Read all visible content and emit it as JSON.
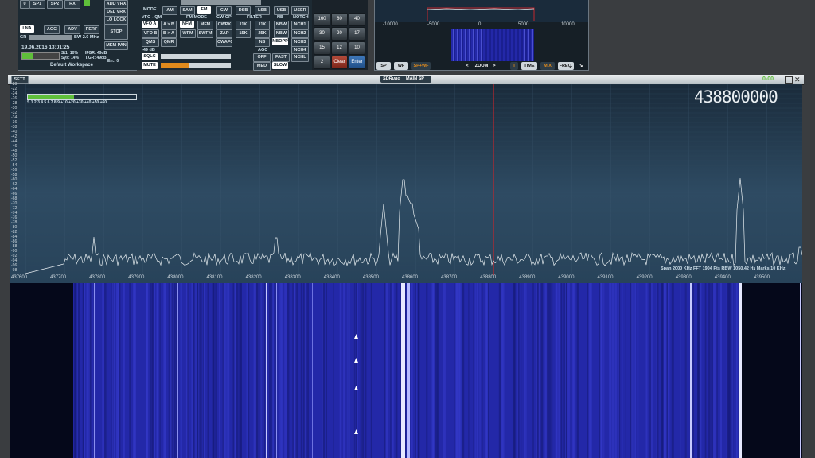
{
  "colors": {
    "accent": "#e08a1c",
    "panel": "#1d2a33",
    "spectrum_line": "#e6edf0",
    "waterfall": "#2328a8",
    "marker": "#c1272d",
    "smeter": "#5fbf3a"
  },
  "top_left": {
    "sp1": "SP1",
    "sp2": "SP2",
    "rx": "RX",
    "add_vrx": "ADD VRX",
    "del_vrx": "DEL VRX",
    "lo_lock": "LO LOCK",
    "lna": "LNA",
    "agc": "AGC",
    "adv": "ADV",
    "perf": "PERF",
    "gr": "GR",
    "bw": "BW 2.0 MHz",
    "stop": "STOP",
    "mem_pan": "MEM PAN",
    "datetime": "19.06.2016 13:01:25",
    "st": "St1: 10%",
    "sys": "Sys: 14%",
    "ifgr": "IFGR: 49dB",
    "tgr": "T.GR: 49dB",
    "err": "Err.: 0",
    "workspace": "Default Workspace"
  },
  "mode_panel": {
    "mode_label": "MODE",
    "modes": [
      "AM",
      "SAM",
      "FM",
      "CW",
      "DSB",
      "LSB",
      "USB",
      "USER"
    ],
    "vfo_label": "VFO - QM",
    "fm_label": "FM MODE",
    "cwop_label": "CW OP",
    "filter_label": "FILTER",
    "nb_label": "NB",
    "notch_label": "NOTCH",
    "vfoa": "VFO A",
    "atob": "A > B",
    "nfm": "NFM",
    "mfm": "MFM",
    "cwpk": "CWPK",
    "k11": "11K",
    "nbw": "NBW",
    "nch1": "NCH1",
    "vfob": "VFO B",
    "btoa": "B > A",
    "wfm": "WFM",
    "swfm": "SWFM",
    "zap": "ZAP",
    "k15": "15K",
    "k25": "25K",
    "nbw2": "NBW",
    "nch2": "NCH2",
    "qms": "QMS",
    "qmr": "QMR",
    "cwafc": "CWAFC",
    "ns": "NS",
    "nbopp": "NBOPP",
    "nch3": "NCH3",
    "nch4": "NCH4",
    "nchl": "NCHL",
    "db": "-49 dB",
    "agc_label": "AGC",
    "sqlc": "SQLC",
    "off": "OFF",
    "fast": "FAST",
    "mute": "MUTE",
    "med": "MED",
    "slow": "SLOW"
  },
  "keypad": {
    "keys": [
      "160",
      "80",
      "40",
      "30",
      "20",
      "17",
      "15",
      "12",
      "10",
      "2",
      "Clear",
      "Enter"
    ]
  },
  "mini_panel": {
    "ticks": [
      "-10000",
      "-5000",
      "0",
      "5000",
      "10000"
    ],
    "tabs": [
      "SP",
      "WF",
      "SP+WF"
    ],
    "zoom_left": "<",
    "zoom": "ZOOM",
    "zoom_right": ">",
    "i": "i",
    "time": "TIME",
    "mix": "MIX",
    "freq": "FREQ.",
    "arrow": "↘"
  },
  "main_window": {
    "sett": "SETT.",
    "brand": "SDRuno",
    "tab": "MAIN SP",
    "dual": "0-00",
    "frequency": "438800000",
    "smeter_scale": "S 1 2 3 4 5 6 7 8 9 +10 +20 +30 +40 +50 +60",
    "db_scale": [
      "-20",
      "-22",
      "-24",
      "-26",
      "-28",
      "-30",
      "-32",
      "-34",
      "-36",
      "-38",
      "-40",
      "-42",
      "-44",
      "-46",
      "-48",
      "-50",
      "-52",
      "-54",
      "-56",
      "-58",
      "-60",
      "-62",
      "-64",
      "-66",
      "-68",
      "-70",
      "-72",
      "-74",
      "-76",
      "-78",
      "-80",
      "-82",
      "-84",
      "-86",
      "-88",
      "-90",
      "-92",
      "-94",
      "-96",
      "-98"
    ],
    "freq_scale": [
      "437600",
      "437700",
      "437800",
      "437900",
      "438000",
      "438100",
      "438200",
      "438300",
      "438400",
      "438500",
      "438600",
      "438700",
      "438800",
      "438900",
      "439000",
      "439100",
      "439200",
      "439300",
      "439400",
      "439500"
    ],
    "info": "Span 2000 KHz   FFT 1904 Pts   RBW 1050.42 Hz   Marks 10 KHz"
  }
}
